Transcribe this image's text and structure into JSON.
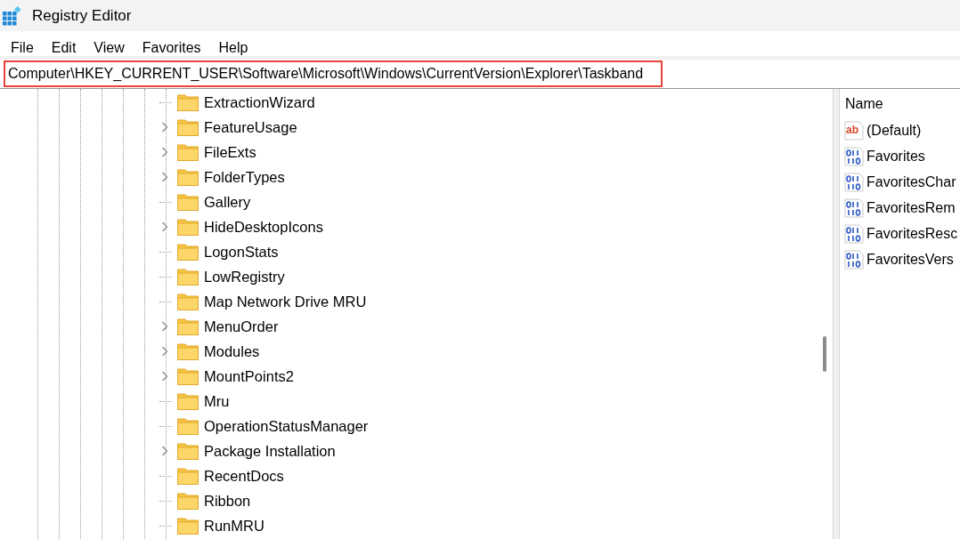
{
  "window": {
    "title": "Registry Editor"
  },
  "menu": [
    "File",
    "Edit",
    "View",
    "Favorites",
    "Help"
  ],
  "address_bar": {
    "path": "Computer\\HKEY_CURRENT_USER\\Software\\Microsoft\\Windows\\CurrentVersion\\Explorer\\Taskband",
    "highlighted": true
  },
  "tree": [
    {
      "label": "ExtractionWizard",
      "expandable": false
    },
    {
      "label": "FeatureUsage",
      "expandable": true
    },
    {
      "label": "FileExts",
      "expandable": true
    },
    {
      "label": "FolderTypes",
      "expandable": true
    },
    {
      "label": "Gallery",
      "expandable": false
    },
    {
      "label": "HideDesktopIcons",
      "expandable": true
    },
    {
      "label": "LogonStats",
      "expandable": false
    },
    {
      "label": "LowRegistry",
      "expandable": false
    },
    {
      "label": "Map Network Drive MRU",
      "expandable": false
    },
    {
      "label": "MenuOrder",
      "expandable": true
    },
    {
      "label": "Modules",
      "expandable": true
    },
    {
      "label": "MountPoints2",
      "expandable": true
    },
    {
      "label": "Mru",
      "expandable": false
    },
    {
      "label": "OperationStatusManager",
      "expandable": false
    },
    {
      "label": "Package Installation",
      "expandable": true
    },
    {
      "label": "RecentDocs",
      "expandable": false
    },
    {
      "label": "Ribbon",
      "expandable": false
    },
    {
      "label": "RunMRU",
      "expandable": false
    }
  ],
  "values": {
    "columns": [
      "Name"
    ],
    "rows": [
      {
        "name": "(Default)",
        "kind": "string",
        "icon_label": "ab"
      },
      {
        "name": "Favorites",
        "kind": "binary"
      },
      {
        "name": "FavoritesChar",
        "kind": "binary"
      },
      {
        "name": "FavoritesRem",
        "kind": "binary"
      },
      {
        "name": "FavoritesResc",
        "kind": "binary"
      },
      {
        "name": "FavoritesVers",
        "kind": "binary"
      }
    ]
  }
}
